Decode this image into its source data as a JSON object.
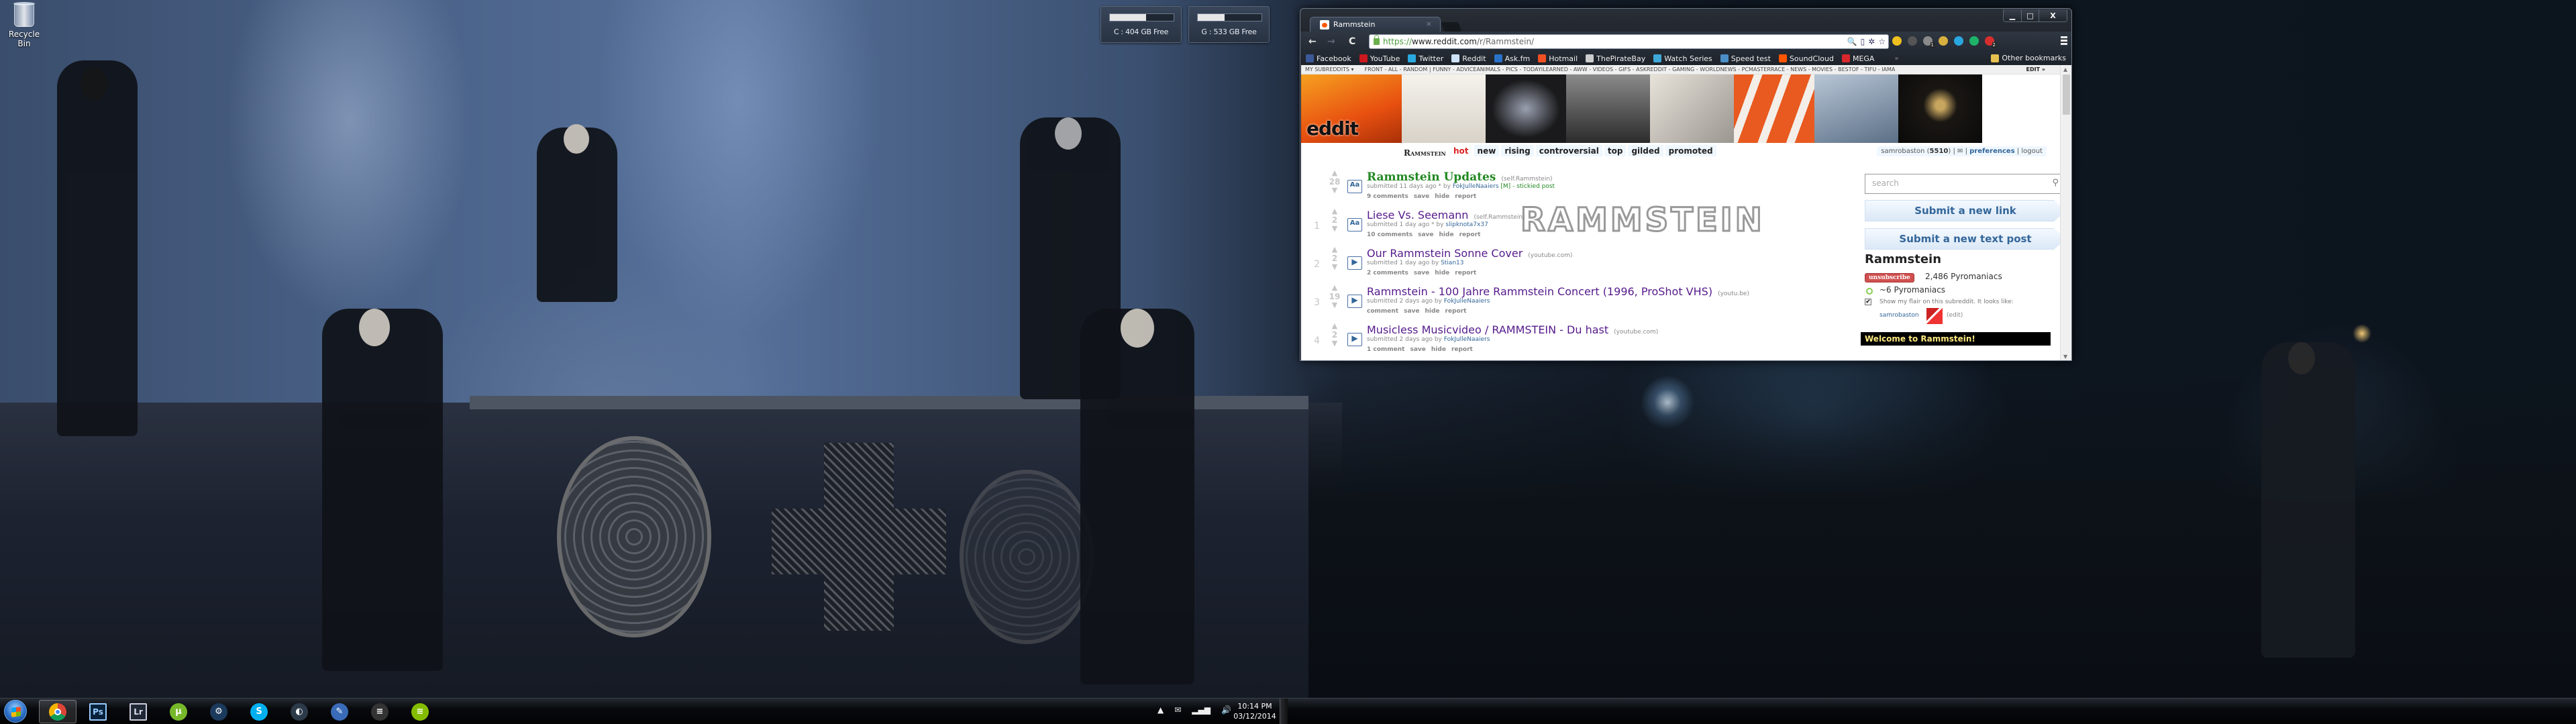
{
  "desktop": {
    "icons": [
      {
        "label": "Recycle Bin",
        "icon": "recycle-bin-icon"
      }
    ],
    "drive_gadgets": [
      {
        "label": "C : 404 GB Free",
        "fill_fraction": 0.57
      },
      {
        "label": "G : 533 GB Free",
        "fill_fraction": 0.42
      }
    ]
  },
  "browser": {
    "window_controls": {
      "minimize": "▁",
      "maximize": "□",
      "close": "X"
    },
    "tab": {
      "title": "Rammstein",
      "close": "×"
    },
    "nav": {
      "back": "←",
      "forward": "→",
      "reload": "C"
    },
    "url": {
      "scheme": "https://",
      "host": "www.reddit.com",
      "path": "/r/Rammstein/"
    },
    "omnibox_icons": [
      "zoom-icon",
      "device-icon",
      "extension-icon",
      "star-icon"
    ],
    "extension_icons": [
      {
        "name": "tab-to-phone-icon",
        "color": "#f0c020"
      },
      {
        "name": "disabled-extension-icon",
        "color": "#555555"
      },
      {
        "name": "ghostery-icon",
        "color": "#8a8a8a",
        "badge": "1"
      },
      {
        "name": "package-icon",
        "color": "#d8b040"
      },
      {
        "name": "c-extension-icon",
        "color": "#2aa7e0"
      },
      {
        "name": "green-extension-icon",
        "color": "#1fb36a"
      },
      {
        "name": "adblock-plus-icon",
        "color": "#d62e2e",
        "badge": "2"
      }
    ],
    "bookmarks": [
      {
        "label": "Facebook",
        "icon": "facebook-icon",
        "color": "#3b5998"
      },
      {
        "label": "YouTube",
        "icon": "youtube-icon",
        "color": "#cc181e"
      },
      {
        "label": "Twitter",
        "icon": "twitter-icon",
        "color": "#2aa9e0"
      },
      {
        "label": "Reddit",
        "icon": "reddit-icon",
        "color": "#cee3f8"
      },
      {
        "label": "Ask.fm",
        "icon": "askfm-icon",
        "color": "#2a72c8"
      },
      {
        "label": "Hotmail",
        "icon": "hotmail-icon",
        "color": "#f25022"
      },
      {
        "label": "ThePirateBay",
        "icon": "piratebay-icon",
        "color": "#cccccc"
      },
      {
        "label": "Watch Series",
        "icon": "watchseries-icon",
        "color": "#3fa8d8"
      },
      {
        "label": "Speed test",
        "icon": "speedtest-icon",
        "color": "#4a8ec8"
      },
      {
        "label": "SoundCloud",
        "icon": "soundcloud-icon",
        "color": "#ff5500"
      },
      {
        "label": "MEGA",
        "icon": "mega-icon",
        "color": "#d9272e"
      }
    ],
    "bookmarks_overflow": "»",
    "other_bookmarks": "Other bookmarks"
  },
  "reddit": {
    "subreddit_bar": {
      "my_subreddits": "MY SUBREDDITS ▾",
      "links": "FRONT - ALL - RANDOM  |  FUNNY - ADVICEANIMALS - PICS - TODAYILEARNED - AWW - VIDEOS - GIFS - ASKREDDIT - GAMING - WORLDNEWS - PCMASTERRACE - NEWS - MOVIES - BESTOF - TIFU - IAMA",
      "edit": "EDIT »"
    },
    "header": {
      "logo_text": "eddit",
      "subreddit_name": "Rammstein",
      "sort_tabs": [
        "hot",
        "new",
        "rising",
        "controversial",
        "top",
        "gilded",
        "promoted"
      ],
      "active_tab": "hot",
      "user": {
        "name": "samrobaston",
        "karma": "5510",
        "preferences": "preferences",
        "logout": "logout"
      }
    },
    "banner_logo": "RAMMSTEIN",
    "posts": [
      {
        "rank": "",
        "score": "28",
        "title": "Rammstein Updates",
        "domain": "(self.Rammstein)",
        "thumb": "Aa",
        "tagline_prefix": "submitted 11 days ago * by",
        "author": "FokJulleNaaiers",
        "tagline_suffix": "[M] - stickied post",
        "comments": "9 comments",
        "sticky": true
      },
      {
        "rank": "1",
        "score": "2",
        "title": "Liese Vs. Seemann",
        "domain": "(self.Rammstein)",
        "thumb": "Aa",
        "tagline_prefix": "submitted 1 day ago * by",
        "author": "slipknota7x37",
        "tagline_suffix": "",
        "comments": "10 comments",
        "sticky": false
      },
      {
        "rank": "2",
        "score": "2",
        "title": "Our Rammstein Sonne Cover",
        "domain": "(youtube.com)",
        "thumb": "▶",
        "tagline_prefix": "submitted 1 day ago by",
        "author": "Stian13",
        "tagline_suffix": "",
        "comments": "2 comments",
        "sticky": false
      },
      {
        "rank": "3",
        "score": "19",
        "title": "Rammstein - 100 Jahre Rammstein Concert (1996, ProShot VHS)",
        "domain": "(youtu.be)",
        "thumb": "▶",
        "tagline_prefix": "submitted 2 days ago by",
        "author": "FokJulleNaaiers",
        "tagline_suffix": "",
        "comments": "comment",
        "sticky": false
      },
      {
        "rank": "4",
        "score": "2",
        "title": "Musicless Musicvideo / RAMMSTEIN - Du hast",
        "domain": "(youtube.com)",
        "thumb": "▶",
        "tagline_prefix": "submitted 2 days ago by",
        "author": "FokJulleNaaiers",
        "tagline_suffix": "",
        "comments": "1 comment",
        "sticky": false
      }
    ],
    "post_actions": {
      "save": "save",
      "hide": "hide",
      "report": "report"
    },
    "sidebar": {
      "search_placeholder": "search",
      "submit_link": "Submit a new link",
      "submit_text": "Submit a new text post",
      "title": "Rammstein",
      "unsubscribe": "unsubscribe",
      "subscribers": "2,486 Pyromaniacs",
      "online": "~6 Pyromaniacs",
      "flair_checkbox": "Show my flair on this subreddit. It looks like:",
      "flair_user": "samrobaston",
      "flair_edit": "(edit)",
      "welcome": "Welcome to Rammstein!"
    }
  },
  "taskbar": {
    "apps": [
      {
        "name": "chrome",
        "label": "",
        "color": "#db4437",
        "active": true
      },
      {
        "name": "photoshop",
        "label": "Ps"
      },
      {
        "name": "lightroom",
        "label": "Lr"
      },
      {
        "name": "utorrent",
        "label": "µ",
        "color": "#77b82a"
      },
      {
        "name": "steam",
        "label": "⚙",
        "color": "#1b3a5c"
      },
      {
        "name": "skype",
        "label": "S",
        "color": "#00aff0"
      },
      {
        "name": "teamspeak",
        "label": "◐",
        "color": "#2c3a4a"
      },
      {
        "name": "notepad-editor",
        "label": "✎",
        "color": "#3a6bb8"
      },
      {
        "name": "groove-app",
        "label": "≡",
        "color": "#333333"
      },
      {
        "name": "spotify",
        "label": "≋",
        "color": "#84bd00"
      }
    ],
    "tray": {
      "show_hidden": "▲",
      "time": "10:14 PM",
      "date": "03/12/2014"
    }
  }
}
